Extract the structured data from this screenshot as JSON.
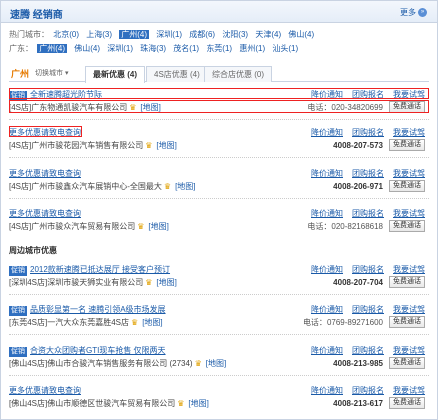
{
  "header": {
    "title": "速腾 经销商",
    "more": "更多"
  },
  "cities_hot": {
    "label": "热门城市：",
    "items": [
      {
        "name": "北京(0)",
        "sel": false
      },
      {
        "name": "上海(3)",
        "sel": false
      },
      {
        "name": "广州(4)",
        "sel": true
      },
      {
        "name": "深圳(1)",
        "sel": false
      },
      {
        "name": "成都(6)",
        "sel": false
      },
      {
        "name": "沈阳(3)",
        "sel": false
      },
      {
        "name": "天津(4)",
        "sel": false
      },
      {
        "name": "佛山(4)",
        "sel": false
      }
    ]
  },
  "cities_gd": {
    "label": "广东：",
    "items": [
      {
        "name": "广州(4)",
        "sel": true
      },
      {
        "name": "佛山(4)",
        "sel": false
      },
      {
        "name": "深圳(1)",
        "sel": false
      },
      {
        "name": "珠海(3)",
        "sel": false
      },
      {
        "name": "茂名(1)",
        "sel": false
      },
      {
        "name": "东莞(1)",
        "sel": false
      },
      {
        "name": "惠州(1)",
        "sel": false
      },
      {
        "name": "汕头(1)",
        "sel": false
      }
    ]
  },
  "tabs_bar": {
    "city": "广州",
    "switch": "切换城市 ▾",
    "tabs": [
      "最新优惠 (4)",
      "4S店优惠 (4)",
      "综合店优惠 (0)"
    ]
  },
  "actions": [
    "降价通知",
    "团购报名",
    "我要试驾"
  ],
  "call": "免费通话",
  "map": "[地图]",
  "section_label": "周边城市优惠",
  "items": [
    {
      "badge": "促销",
      "title": "全新速腾超光阶节际",
      "dealer": "[4S店]广东物通凯骏汽车有限公司",
      "phone_label": "电话：",
      "phone": "020-34820699",
      "bold": false
    },
    {
      "badge": "",
      "title": "更多优惠请致电查询",
      "dealer": "[4S店]广州市骏花园汽车销售有限公司",
      "phone_label": "",
      "phone": "4008-207-573",
      "bold": true
    },
    {
      "badge": "",
      "title": "更多优惠请致电查询",
      "dealer": "[4S店]广州市骏鑫众汽车展销中心-全国最大",
      "phone_label": "",
      "phone": "4008-206-971",
      "bold": true
    },
    {
      "badge": "",
      "title": "更多优惠请致电查询",
      "dealer": "[4S店]广州市骏众汽车贸易有限公司",
      "phone_label": "电话：",
      "phone": "020-82168618",
      "bold": false
    },
    {
      "badge": "促销",
      "title": "2012款新速腾已抵达展厅 接受客户预订",
      "dealer": "[深圳4S店]深圳市骏天狮实业有限公司",
      "phone_label": "",
      "phone": "4008-207-704",
      "bold": true
    },
    {
      "badge": "促销",
      "title": "品质彰显第一名 速腾引领A级市场发展",
      "dealer": "[东莞4S店]一汽大众东莞嘉胜4S店",
      "phone_label": "电话：",
      "phone": "0769-89271600",
      "bold": false
    },
    {
      "badge": "促销",
      "title": "合资大众团购者GTI现车抢售 仅限两天",
      "dealer": "[佛山4S店]佛山市合骏汽车销售服务有限公司 (2734)",
      "phone_label": "",
      "phone": "4008-213-985",
      "bold": true
    },
    {
      "badge": "",
      "title": "更多优惠请致电查询",
      "dealer": "[佛山4S店]佛山市顺德区世骏汽车贸易有限公司",
      "phone_label": "",
      "phone": "4008-213-617",
      "bold": true
    }
  ]
}
